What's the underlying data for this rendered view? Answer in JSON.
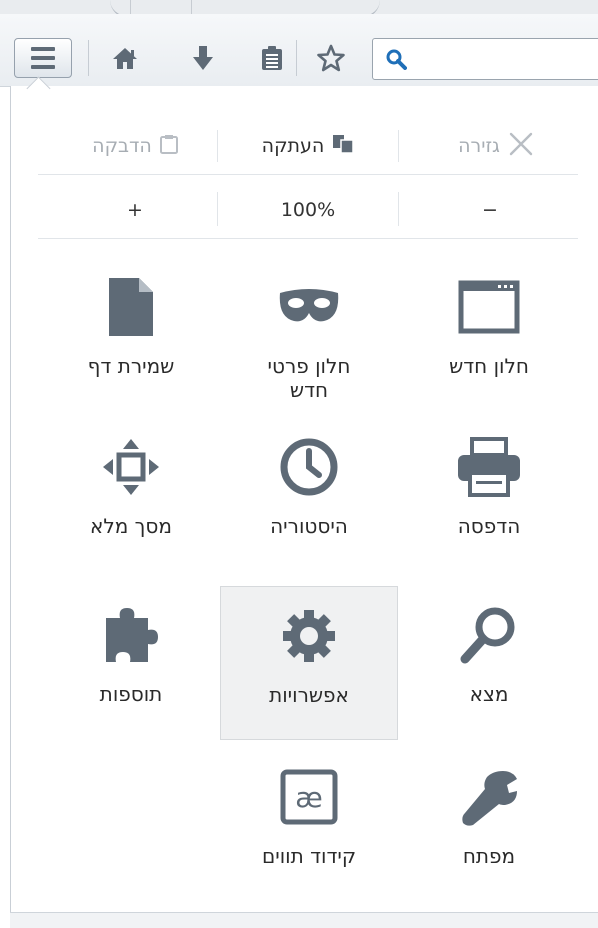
{
  "toolbar": {
    "menu_button": "menu-icon",
    "icons": [
      "home-icon",
      "download-icon",
      "reading-list-icon",
      "bookmark-star-icon"
    ],
    "search_placeholder": ""
  },
  "edit_row": {
    "cut": "גזירה",
    "copy": "העתקה",
    "paste": "הדבקה"
  },
  "zoom_row": {
    "minus": "−",
    "level": "100%",
    "plus": "+"
  },
  "grid": [
    {
      "id": "new-window",
      "label": "חלון חדש",
      "icon": "window-icon"
    },
    {
      "id": "private-window",
      "label": "חלון פרטי חדש",
      "icon": "mask-icon"
    },
    {
      "id": "save-page",
      "label": "שמירת דף",
      "icon": "page-icon"
    },
    {
      "id": "print",
      "label": "הדפסה",
      "icon": "printer-icon"
    },
    {
      "id": "history",
      "label": "היסטוריה",
      "icon": "clock-icon"
    },
    {
      "id": "fullscreen",
      "label": "מסך מלא",
      "icon": "fullscreen-icon"
    },
    {
      "id": "find",
      "label": "מצא",
      "icon": "magnifier-icon"
    },
    {
      "id": "options",
      "label": "אפשרויות",
      "icon": "gear-icon"
    },
    {
      "id": "addons",
      "label": "תוספות",
      "icon": "puzzle-icon"
    },
    {
      "id": "developer",
      "label": "מפתח",
      "icon": "wrench-icon"
    },
    {
      "id": "encoding",
      "label": "קידוד תווים",
      "icon": "encoding-icon"
    }
  ],
  "colors": {
    "icon": "#5e6a76",
    "hover_bg": "#f0f1f2",
    "disabled_text": "#a7adb3"
  }
}
